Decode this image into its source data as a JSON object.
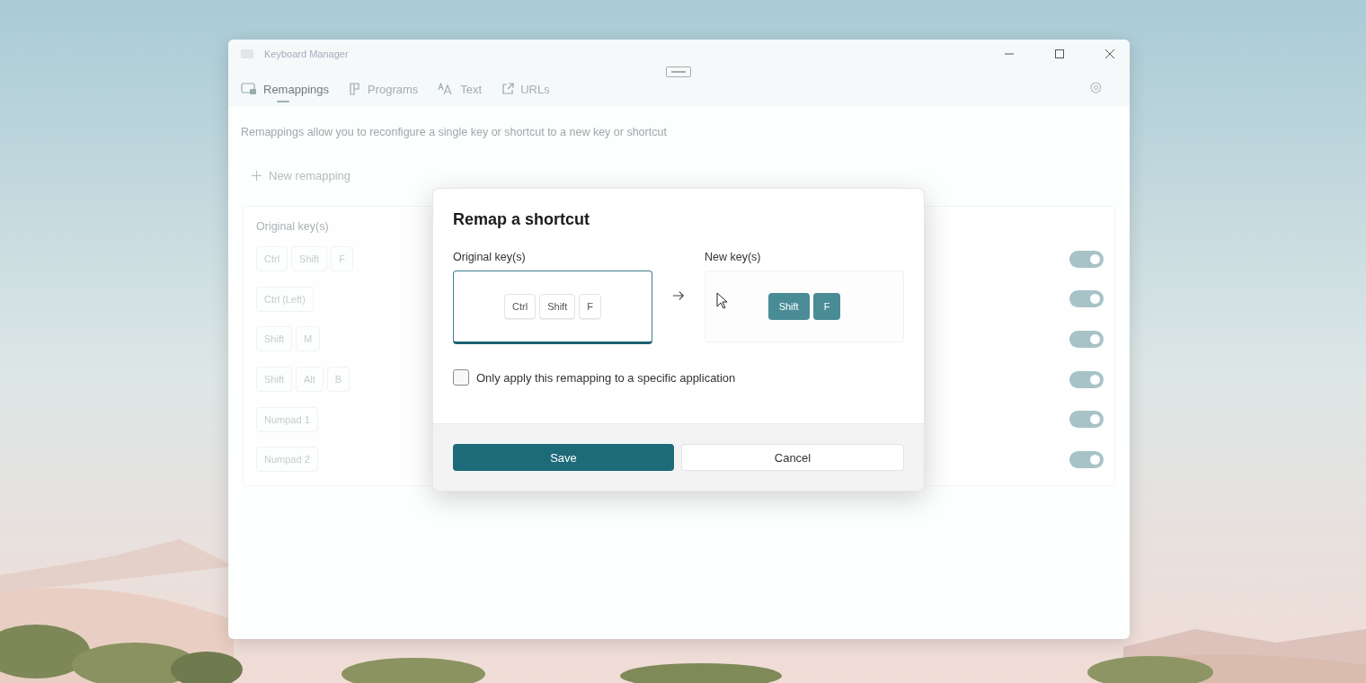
{
  "window": {
    "title": "Keyboard Manager"
  },
  "tabs": [
    {
      "label": "Remappings",
      "selected": true
    },
    {
      "label": "Programs",
      "selected": false
    },
    {
      "label": "Text",
      "selected": false
    },
    {
      "label": "URLs",
      "selected": false
    }
  ],
  "description": "Remappings allow you to reconfigure a single key or shortcut to a new key or shortcut",
  "new_remapping": "New remapping",
  "list": {
    "column_header": "Original key(s)",
    "rows": [
      {
        "keys": [
          "Ctrl",
          "Shift",
          "F"
        ],
        "enabled": true
      },
      {
        "keys": [
          "Ctrl (Left)"
        ],
        "enabled": true
      },
      {
        "keys": [
          "Shift",
          "M"
        ],
        "enabled": true
      },
      {
        "keys": [
          "Shift",
          "Alt",
          "B"
        ],
        "enabled": true
      },
      {
        "keys": [
          "Numpad 1"
        ],
        "enabled": true
      },
      {
        "keys": [
          "Numpad 2"
        ],
        "enabled": true
      }
    ]
  },
  "dialog": {
    "title": "Remap a shortcut",
    "original_label": "Original key(s)",
    "original_keys": [
      "Ctrl",
      "Shift",
      "F"
    ],
    "new_label": "New key(s)",
    "new_keys": [
      "Shift",
      "F"
    ],
    "specific_app": {
      "label": "Only apply this remapping to a specific application",
      "checked": false
    },
    "buttons": [
      {
        "label": "Save",
        "kind": "primary"
      },
      {
        "label": "Cancel",
        "kind": "secondary"
      }
    ]
  }
}
